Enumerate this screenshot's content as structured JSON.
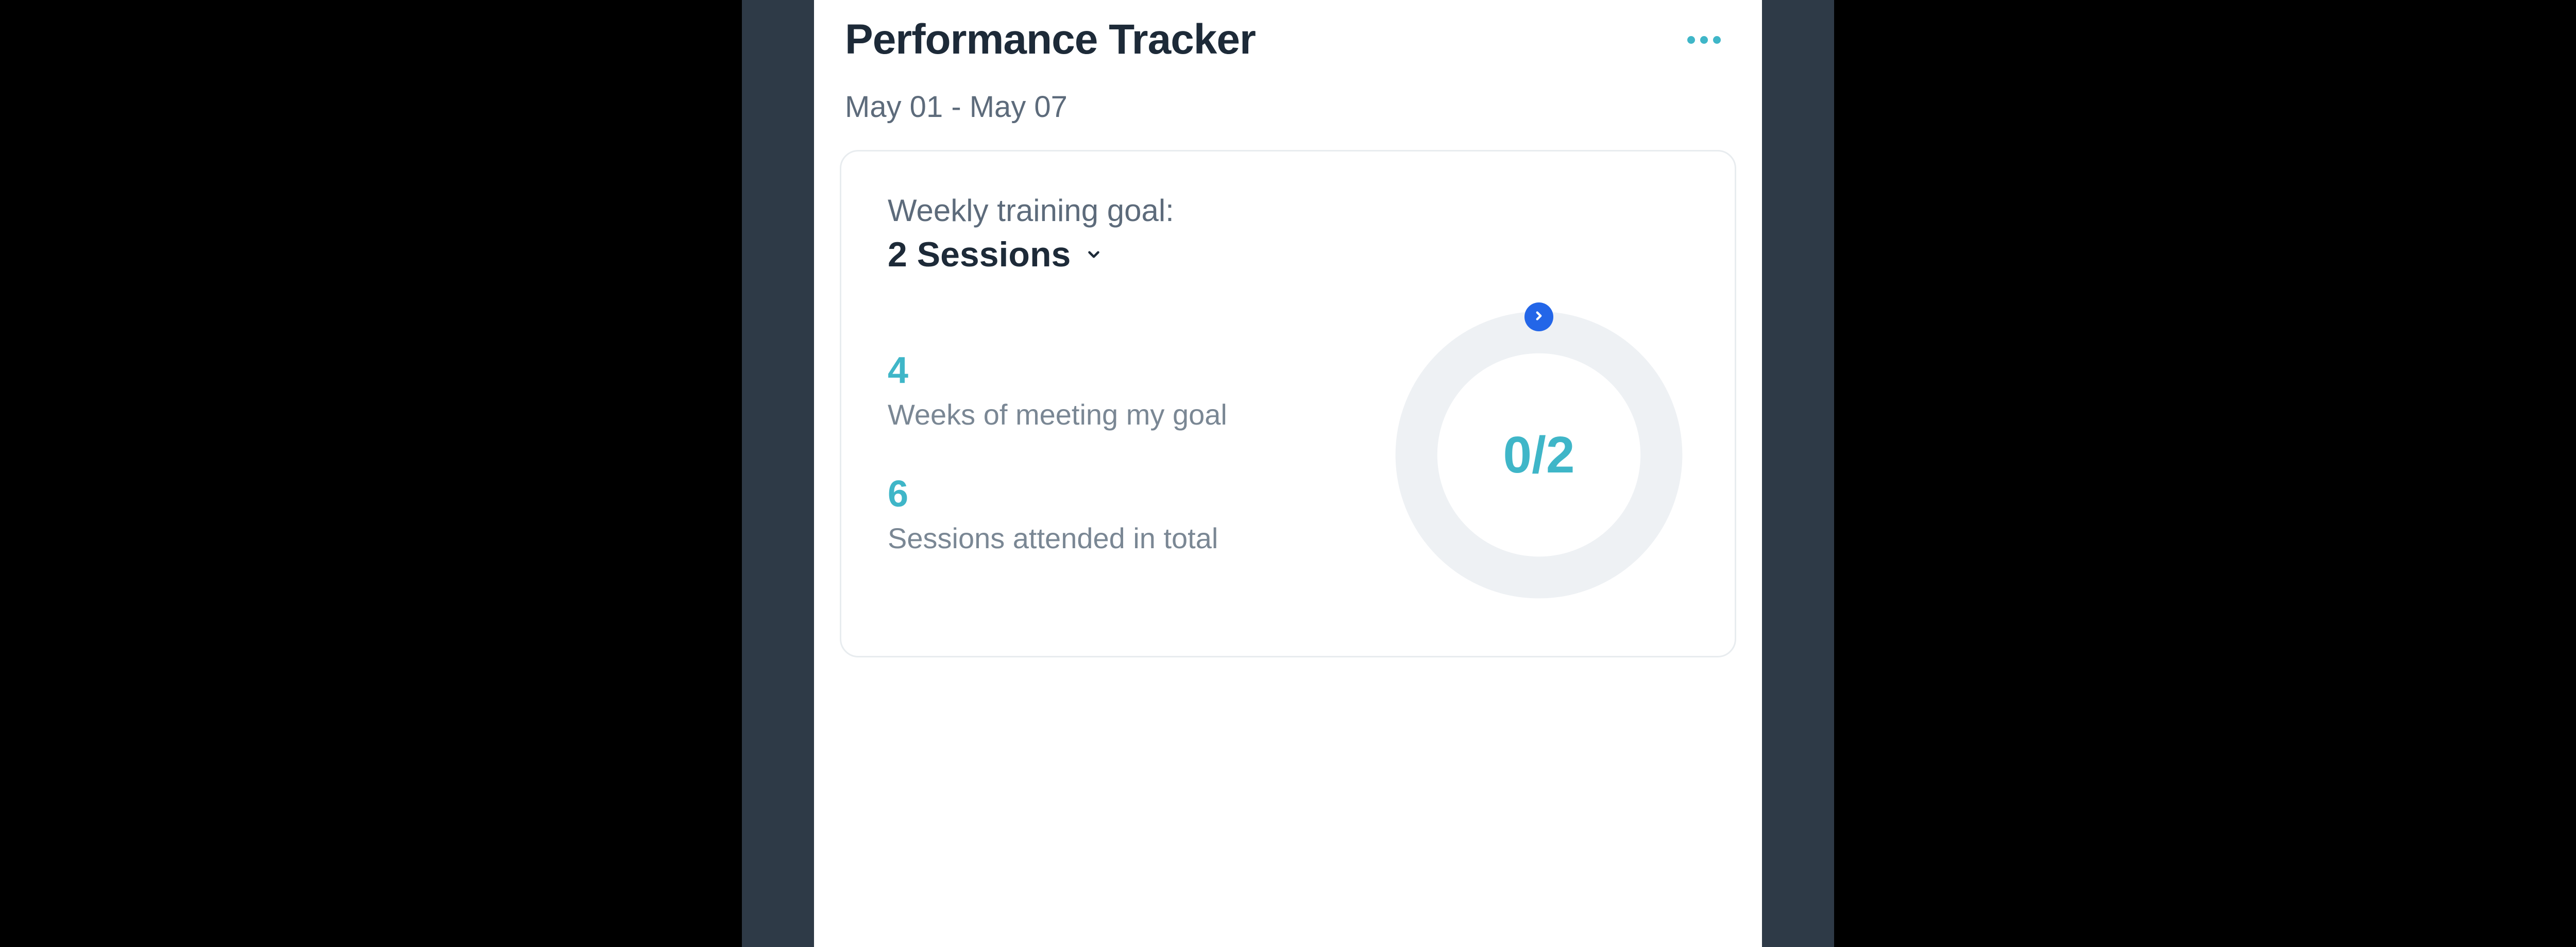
{
  "header": {
    "title": "Performance Tracker"
  },
  "date_range": "May 01 - May 07",
  "goal_card": {
    "label": "Weekly training goal:",
    "value": "2 Sessions",
    "stats": {
      "weeks_meeting_goal": {
        "value": "4",
        "label": "Weeks of meeting my goal"
      },
      "sessions_total": {
        "value": "6",
        "label": "Sessions attended in total"
      }
    },
    "ring": {
      "progress_text": "0/2",
      "completed": 0,
      "target": 2
    }
  },
  "icons": {
    "more": "more-horizontal-icon",
    "chevron_down": "chevron-down-icon",
    "chevron_right": "chevron-right-icon"
  },
  "colors": {
    "accent": "#3fb6c8",
    "badge": "#2366e8",
    "text_dark": "#1d2a38",
    "text_muted": "#7a8794"
  }
}
